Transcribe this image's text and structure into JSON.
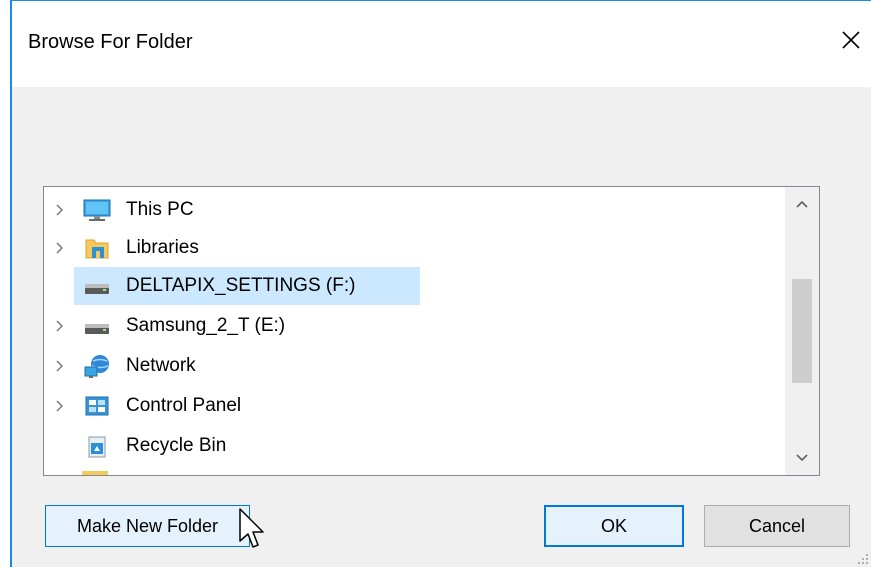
{
  "dialog": {
    "title": "Browse For Folder"
  },
  "tree": {
    "items": [
      {
        "label": "This PC",
        "icon": "monitor-icon",
        "expandable": true,
        "selected": false
      },
      {
        "label": "Libraries",
        "icon": "libraries-folder-icon",
        "expandable": true,
        "selected": false
      },
      {
        "label": "DELTAPIX_SETTINGS (F:)",
        "icon": "drive-icon",
        "expandable": false,
        "selected": true
      },
      {
        "label": "Samsung_2_T (E:)",
        "icon": "drive-icon",
        "expandable": true,
        "selected": false
      },
      {
        "label": "Network",
        "icon": "network-icon",
        "expandable": true,
        "selected": false
      },
      {
        "label": "Control Panel",
        "icon": "control-panel-icon",
        "expandable": true,
        "selected": false
      },
      {
        "label": "Recycle Bin",
        "icon": "recycle-bin-icon",
        "expandable": false,
        "selected": false
      }
    ]
  },
  "buttons": {
    "make_new_folder": "Make New Folder",
    "ok": "OK",
    "cancel": "Cancel"
  },
  "colors": {
    "selection": "#cce8ff",
    "accent": "#0078d7",
    "dialog_bg": "#f0f0f0"
  }
}
